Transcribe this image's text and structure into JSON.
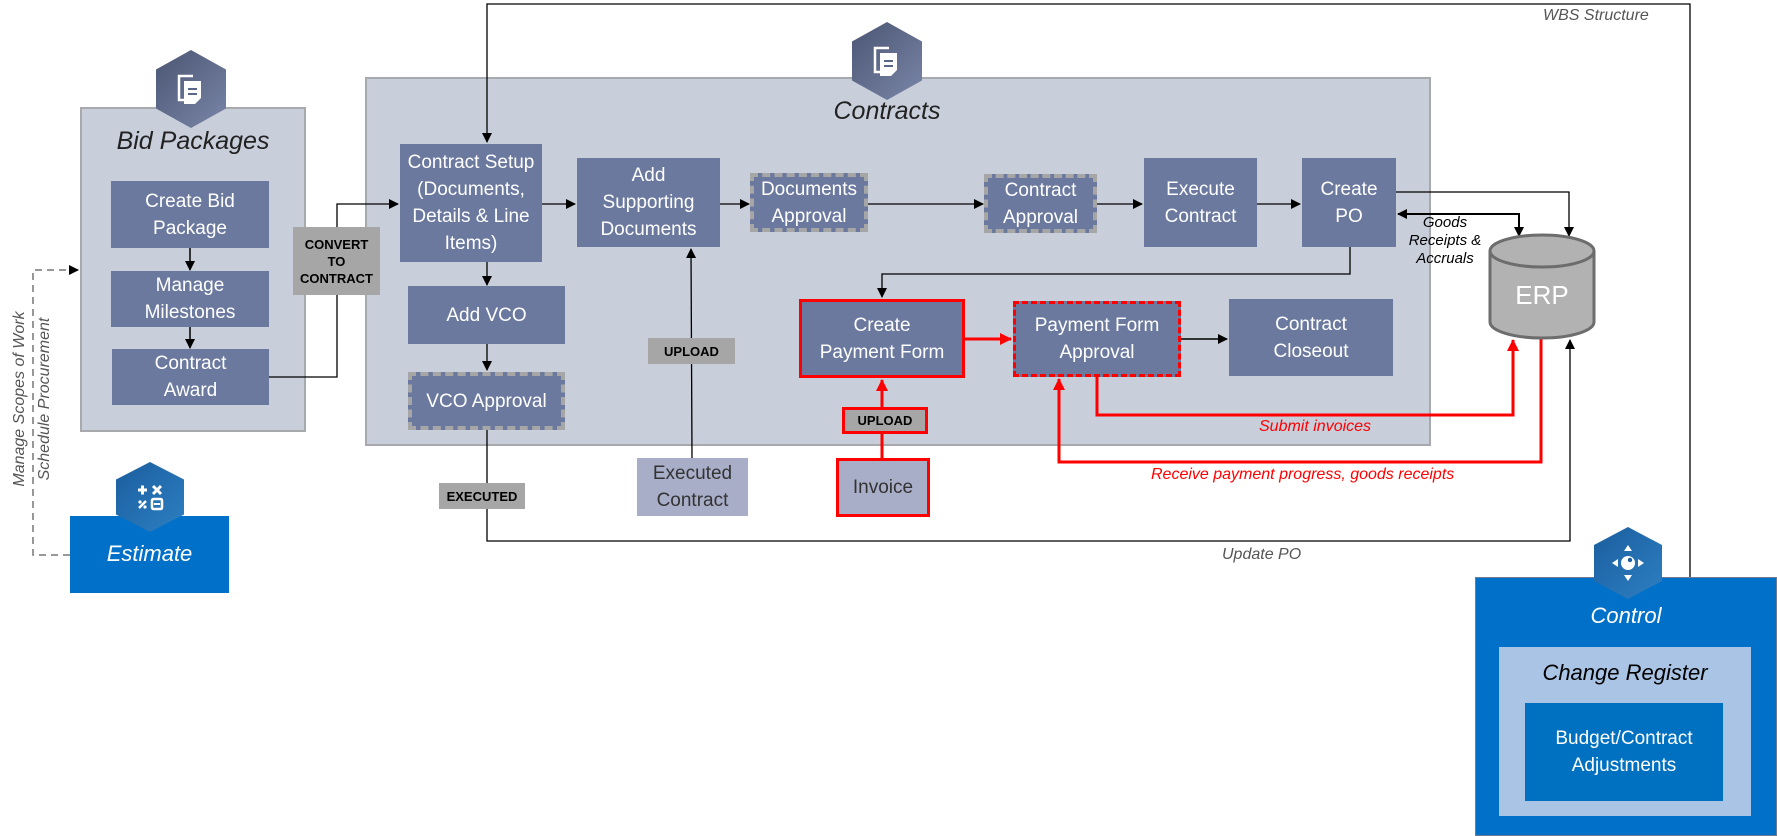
{
  "labels": {
    "wbs_structure": "WBS Structure",
    "update_po": "Update PO",
    "submit_invoices": "Submit invoices",
    "receive_payment": "Receive payment progress, goods receipts",
    "goods_receipts": "Goods\nReceipts &\nAccruals",
    "manage_scopes": "Manage Scopes of Work",
    "schedule_procurement": "Schedule Procurement"
  },
  "bid_packages": {
    "title": "Bid Packages",
    "icon": "document-stack-icon",
    "steps": [
      "Create Bid\nPackage",
      "Manage\nMilestones",
      "Contract\nAward"
    ]
  },
  "convert_tag": "CONVERT\nTO\nCONTRACT",
  "contracts": {
    "title": "Contracts",
    "icon": "document-stack-icon",
    "contract_setup": "Contract Setup\n(Documents,\nDetails & Line\nItems)",
    "add_supporting": "Add\nSupporting\nDocuments",
    "documents_approval": "Documents\nApproval",
    "contract_approval": "Contract\nApproval",
    "execute_contract": "Execute\nContract",
    "create_po": "Create\nPO",
    "add_vco": "Add VCO",
    "vco_approval": "VCO Approval",
    "create_payment_form": "Create\nPayment Form",
    "payment_form_approval": "Payment Form\nApproval",
    "contract_closeout": "Contract\nCloseout"
  },
  "tags": {
    "upload_supporting": "UPLOAD",
    "upload_invoice": "UPLOAD",
    "executed": "EXECUTED"
  },
  "documents": {
    "executed_contract": "Executed\nContract",
    "invoice": "Invoice"
  },
  "erp": {
    "label": "ERP"
  },
  "estimate": {
    "title": "Estimate",
    "icon": "calculator-icon"
  },
  "control": {
    "title": "Control",
    "icon": "joystick-icon",
    "change_register": "Change Register",
    "budget_adjustments": "Budget/Contract\nAdjustments"
  },
  "colors": {
    "step_fill": "#6b799f",
    "container_fill": "#c8ceda",
    "highlight_red": "#ff0000",
    "control_blue": "#0070c8",
    "erp_grey": "#b2b2b2"
  }
}
